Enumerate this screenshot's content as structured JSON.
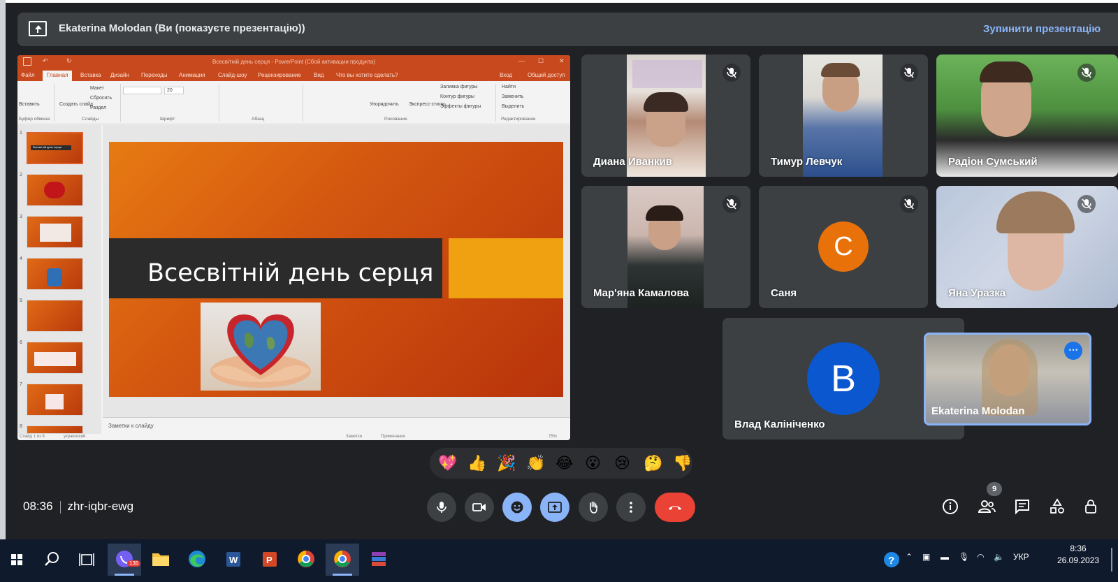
{
  "banner": {
    "title": "Ekaterina Molodan (Ви (показуєте презентацію))",
    "stop_label": "Зупинити презентацію"
  },
  "powerpoint": {
    "window_title": "Всесвітній день серця - PowerPoint (Сбой активации продукта)",
    "tabs": [
      "Файл",
      "Главная",
      "Вставка",
      "Дизайн",
      "Переходы",
      "Анимация",
      "Слайд-шоу",
      "Рецензирование",
      "Вид"
    ],
    "tell_me": "Что вы хотите сделать?",
    "login": "Вход",
    "share": "Общий доступ",
    "ribbon": {
      "paste": "Вставить",
      "new_slide": "Создать слайд",
      "layout": "Макет",
      "reset": "Сбросить",
      "section": "Раздел",
      "font_size": "20",
      "arrange": "Упорядочить",
      "quick_styles": "Экспресс-стили",
      "shape_fill": "Заливка фигуры",
      "shape_outline": "Контур фигуры",
      "shape_effects": "Эффекты фигуры",
      "find": "Найти",
      "replace": "Заменить",
      "select": "Выделить",
      "groups": [
        "Буфер обмена",
        "Слайды",
        "Шрифт",
        "Абзац",
        "Рисование",
        "Редактирование"
      ]
    },
    "slide_title": "Всесвітній день серця",
    "thumb_numbers": [
      "1",
      "2",
      "3",
      "4",
      "5",
      "6",
      "7",
      "8"
    ],
    "thumb1_caption": "Всесвітній день серця",
    "notes_placeholder": "Заметки к слайду",
    "status_left": "Слайд 1 из 8",
    "status_lang": "украинский",
    "status_notes": "Заметки",
    "status_comments": "Примечания",
    "zoom": "75%"
  },
  "participants": [
    {
      "name": "Диана Иванкив",
      "muted": true
    },
    {
      "name": "Тимур Левчук",
      "muted": true
    },
    {
      "name": "Радіон Сумський",
      "muted": true
    },
    {
      "name": "Мар'яна Камалова",
      "muted": true
    },
    {
      "name": "Саня",
      "muted": true,
      "initial": "С",
      "avatar_color": "#e8710a"
    },
    {
      "name": "Яна Уразка",
      "muted": true
    },
    {
      "name": "Влад Калініченко",
      "initial": "B",
      "avatar_color": "#0b57d0"
    },
    {
      "name": "Ekaterina Molodan",
      "self": true
    }
  ],
  "reactions": [
    "💖",
    "👍",
    "🎉",
    "👏",
    "😂",
    "😮",
    "😢",
    "🤔",
    "👎"
  ],
  "meeting": {
    "time": "08:36",
    "code": "zhr-iqbr-ewg",
    "participant_count": "9"
  },
  "controls": [
    "mic-icon",
    "camera-icon",
    "emoji-icon",
    "present-icon",
    "raise-hand-icon",
    "more-options-icon",
    "hang-up-icon"
  ],
  "right_controls": [
    "info-icon",
    "people-icon",
    "chat-icon",
    "activities-icon",
    "host-controls-icon"
  ],
  "taskbar": {
    "apps": [
      "start-icon",
      "search-icon",
      "task-view-icon",
      "viber-icon",
      "file-explorer-icon",
      "edge-icon",
      "word-icon",
      "powerpoint-icon",
      "chrome-icon",
      "chrome-icon",
      "winrar-icon"
    ],
    "viber_badge": "135",
    "language": "УКР",
    "clock_time": "8:36",
    "clock_date": "26.09.2023"
  },
  "colors": {
    "meet_bg": "#202124",
    "tile_bg": "#3c4043",
    "accent_blue": "#8ab4f8",
    "ppt_orange": "#c8491d",
    "hangup_red": "#ea4335"
  }
}
